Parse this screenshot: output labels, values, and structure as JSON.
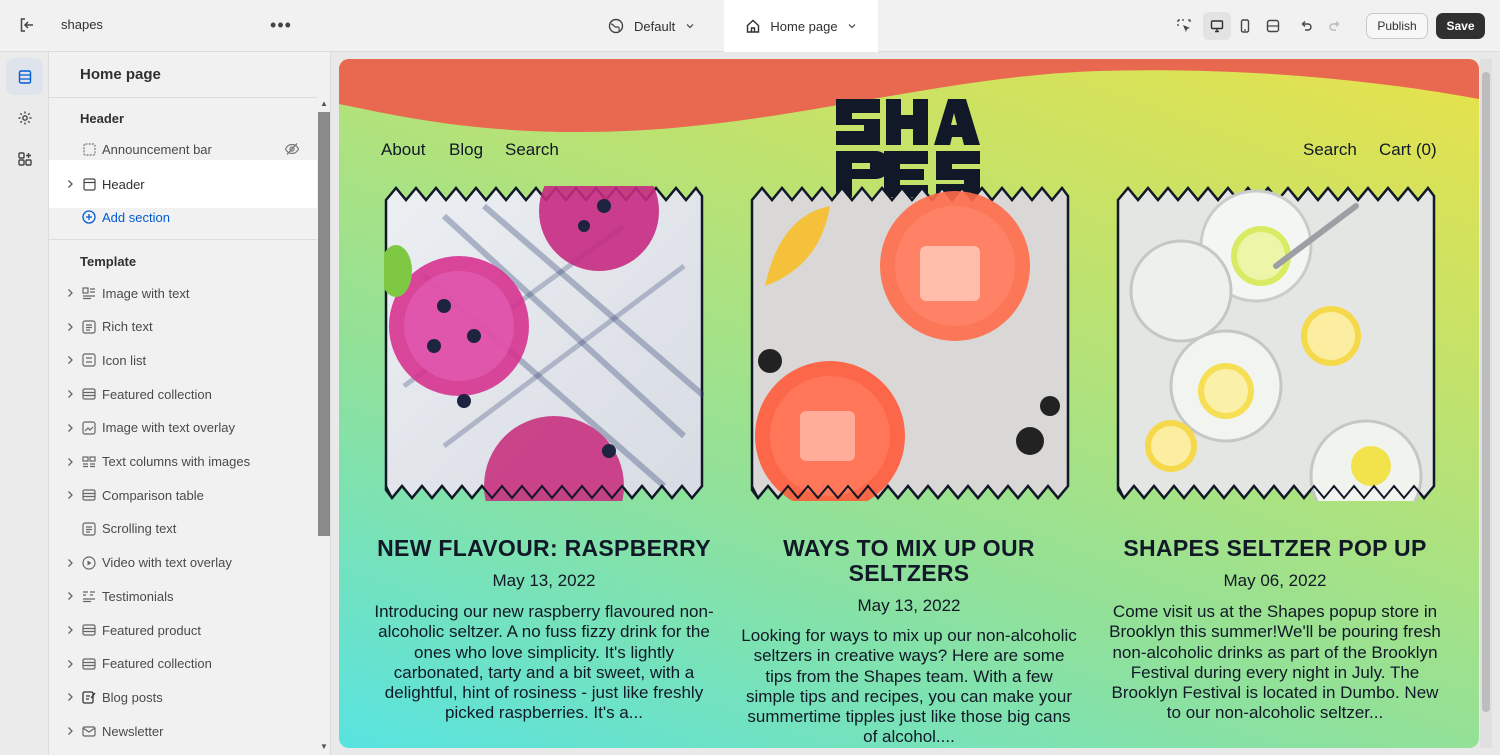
{
  "topbar": {
    "store_name": "shapes",
    "theme_select": "Default",
    "page_select": "Home page",
    "publish_label": "Publish",
    "save_label": "Save"
  },
  "sidebar": {
    "title": "Home page",
    "header_group": {
      "title": "Header",
      "items": [
        {
          "label": "Announcement bar",
          "icon": "section-icon",
          "hidden": true
        },
        {
          "label": "Header",
          "icon": "section-icon",
          "selected": true
        }
      ],
      "add_section": "Add section"
    },
    "template_group": {
      "title": "Template",
      "items": [
        {
          "label": "Image with text",
          "icon": "image-text-icon"
        },
        {
          "label": "Rich text",
          "icon": "text-block-icon"
        },
        {
          "label": "Icon list",
          "icon": "list-icon"
        },
        {
          "label": "Featured collection",
          "icon": "collection-icon"
        },
        {
          "label": "Image with text overlay",
          "icon": "image-overlay-icon"
        },
        {
          "label": "Text columns with images",
          "icon": "columns-icon"
        },
        {
          "label": "Comparison table",
          "icon": "table-icon"
        },
        {
          "label": "Scrolling text",
          "icon": "text-block-icon"
        },
        {
          "label": "Video with text overlay",
          "icon": "play-icon"
        },
        {
          "label": "Testimonials",
          "icon": "quote-icon"
        },
        {
          "label": "Featured product",
          "icon": "product-icon"
        },
        {
          "label": "Featured collection",
          "icon": "collection-icon"
        },
        {
          "label": "Blog posts",
          "icon": "blog-icon"
        },
        {
          "label": "Newsletter",
          "icon": "mail-icon"
        }
      ]
    }
  },
  "preview": {
    "nav_left": [
      "About",
      "Blog",
      "Search"
    ],
    "nav_right": [
      "Search",
      "Cart (0)"
    ],
    "logo_text": "SHAPES",
    "posts": [
      {
        "title": "NEW FLAVOUR: RASPBERRY",
        "date": "May 13, 2022",
        "excerpt": "Introducing our new raspberry flavoured non-alcoholic seltzer.   A no fuss fizzy drink for the ones who love simplicity. It's lightly carbonated, tarty and a bit sweet, with a delightful, hint of rosiness - just like freshly picked raspberries. It's a..."
      },
      {
        "title": "WAYS TO MIX UP OUR SELTZERS",
        "date": "May 13, 2022",
        "excerpt": "Looking for ways to mix up our non-alcoholic seltzers in creative ways? Here are some tips from the Shapes team. With a few simple tips and recipes, you can make your summertime tipples just like those big cans of alcohol...."
      },
      {
        "title": "SHAPES SELTZER POP UP",
        "date": "May 06, 2022",
        "excerpt": "Come visit us at the Shapes popup store in Brooklyn this summer!We'll be pouring fresh non-alcoholic drinks as part of the Brooklyn Festival during every night in July. The Brooklyn Festival is located in Dumbo. New to our non-alcoholic seltzer..."
      }
    ],
    "colors": {
      "wave": "#e8694f",
      "ink": "#111827",
      "accent_blue": "#005bd3"
    }
  }
}
